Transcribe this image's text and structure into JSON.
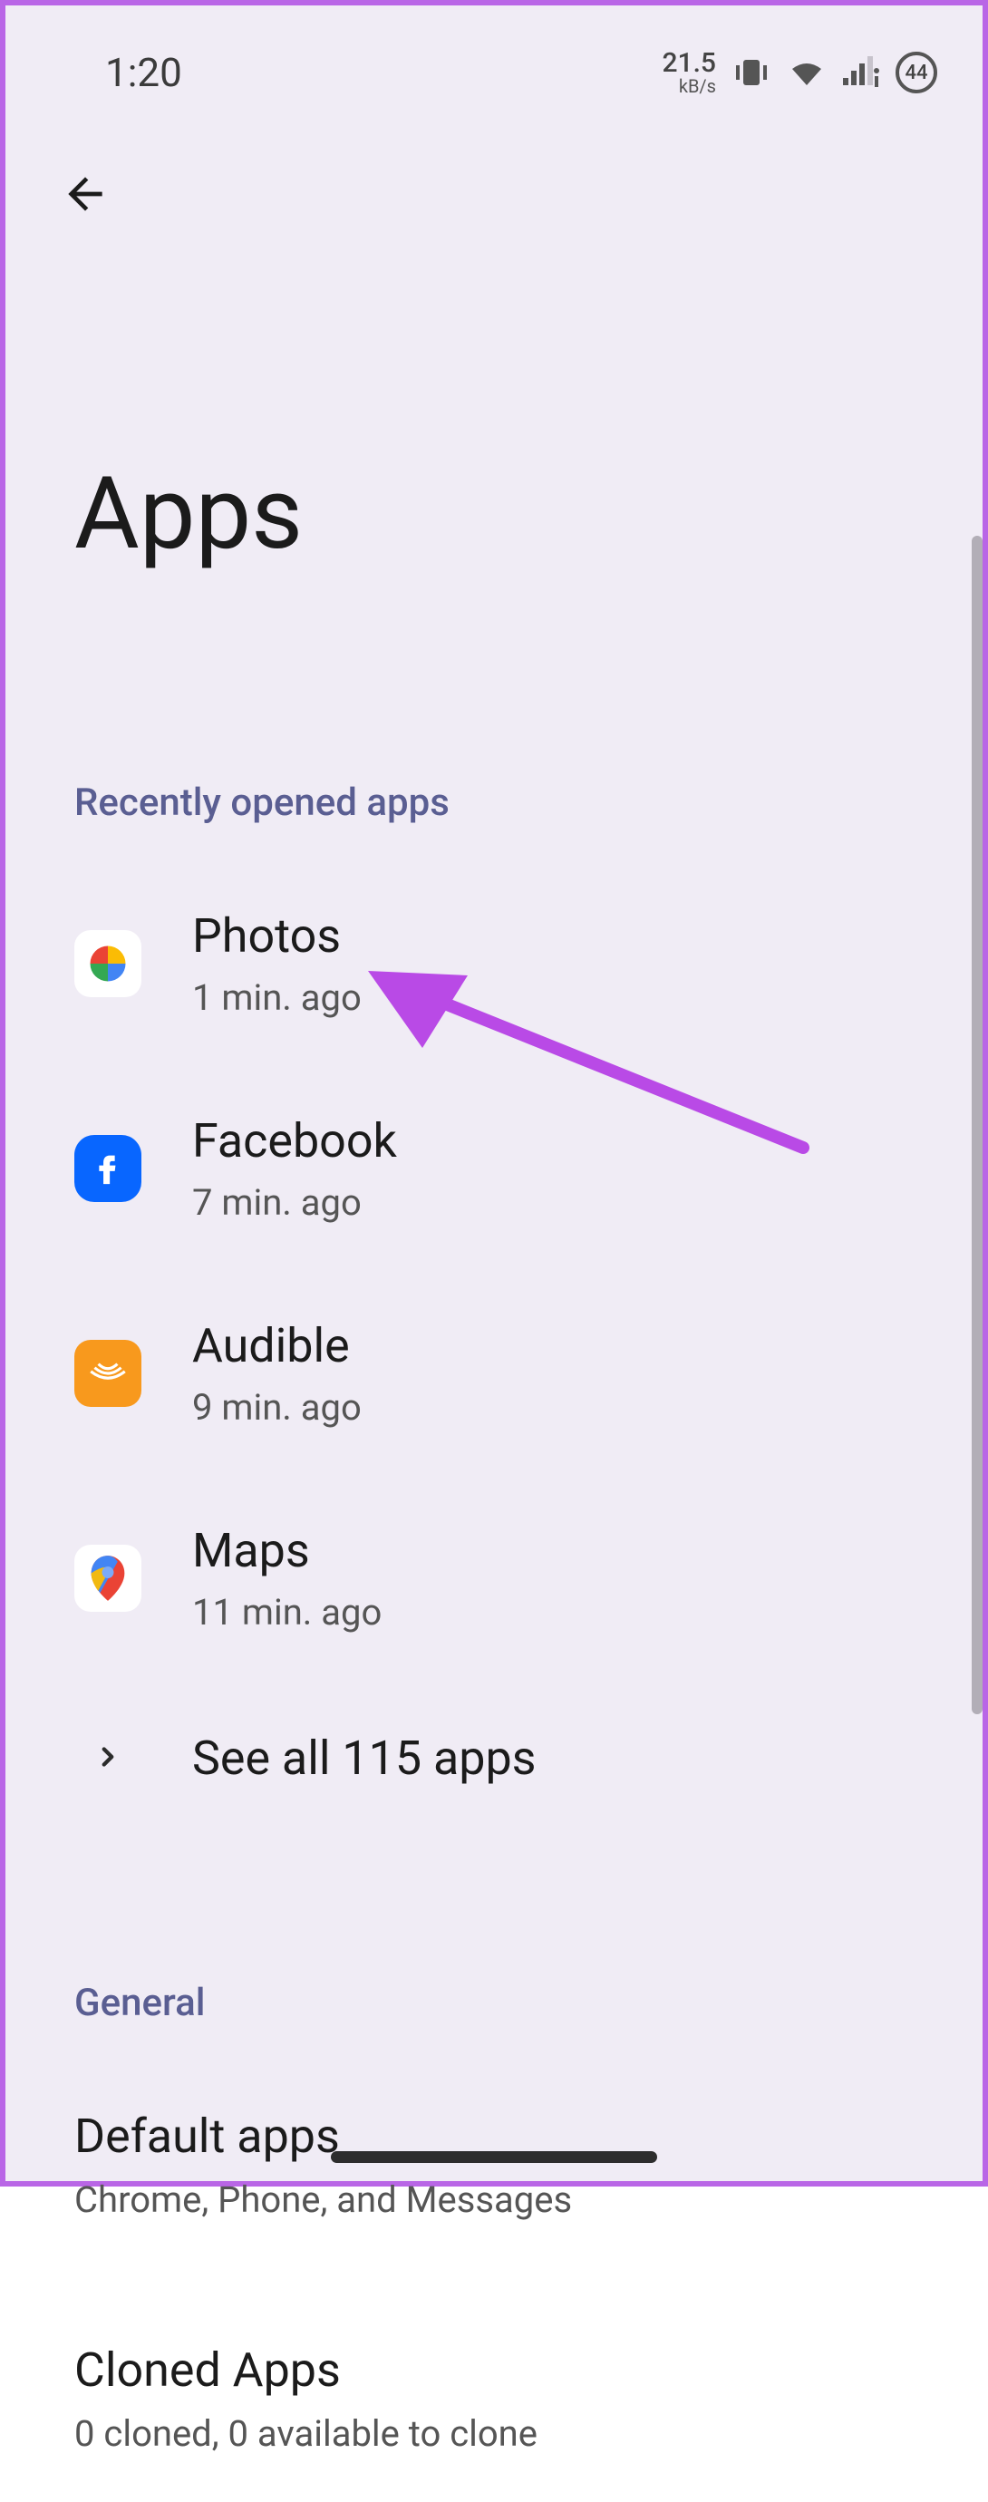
{
  "status": {
    "time": "1:20",
    "net_value": "21.5",
    "net_unit": "kB/s",
    "battery_pct": "44"
  },
  "page": {
    "title": "Apps"
  },
  "sections": {
    "recent_header": "Recently opened apps",
    "general_header": "General"
  },
  "recent": [
    {
      "name": "Photos",
      "sub": "1 min. ago"
    },
    {
      "name": "Facebook",
      "sub": "7 min. ago"
    },
    {
      "name": "Audible",
      "sub": "9 min. ago"
    },
    {
      "name": "Maps",
      "sub": "11 min. ago"
    }
  ],
  "see_all": "See all 115 apps",
  "general": [
    {
      "name": "Default apps",
      "sub": "Chrome, Phone, and Messages"
    },
    {
      "name": "Cloned Apps",
      "sub": "0 cloned, 0 available to clone"
    }
  ]
}
